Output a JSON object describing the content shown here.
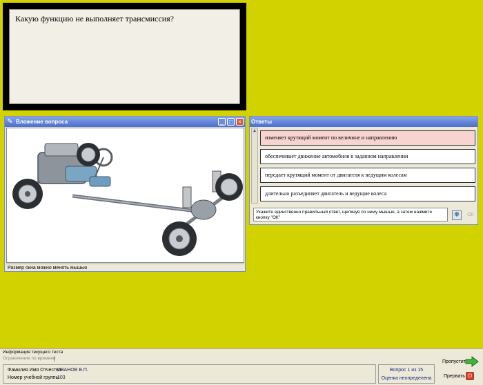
{
  "question": {
    "text": "Какую функцию не выполняет трансмиссия?"
  },
  "image_window": {
    "title": "Вложение вопроса",
    "status": "Размер окна можно менять мышью",
    "icon": "attachment-icon"
  },
  "answers_window": {
    "title": "Ответы",
    "items": [
      {
        "label": "изменяет крутящий момент по величине и направлению",
        "selected": true
      },
      {
        "label": "обеспечивает движение автомобиля в заданном направлении",
        "selected": false
      },
      {
        "label": "передает крутящий момент от двигателя к ведущим колесам",
        "selected": false
      },
      {
        "label": "длительно разъединяет двигатель и ведущие колеса",
        "selected": false
      }
    ],
    "hint": "Укажите единственно правильный ответ, щелкнув по нему мышью, а затем нажмите кнопку \"ОК\"",
    "ok_label": "ОК"
  },
  "bottom": {
    "info_title": "Информация текущего теста",
    "limit": "Ограничение по времени",
    "fio_label": "Фамилия Имя Отчество",
    "fio_value": "ИВАНОВ В.П.",
    "group_label": "Номер учебной группы",
    "group_value": "103",
    "question_progress": "Вопрос 1 из 15",
    "grade": "Оценка неопределена",
    "skip_label": "Пропустить",
    "stop_label": "Прервать"
  },
  "colors": {
    "background": "#d2d200",
    "selected_answer": "#f7d4d0",
    "titlebar": "#5f82d6"
  }
}
